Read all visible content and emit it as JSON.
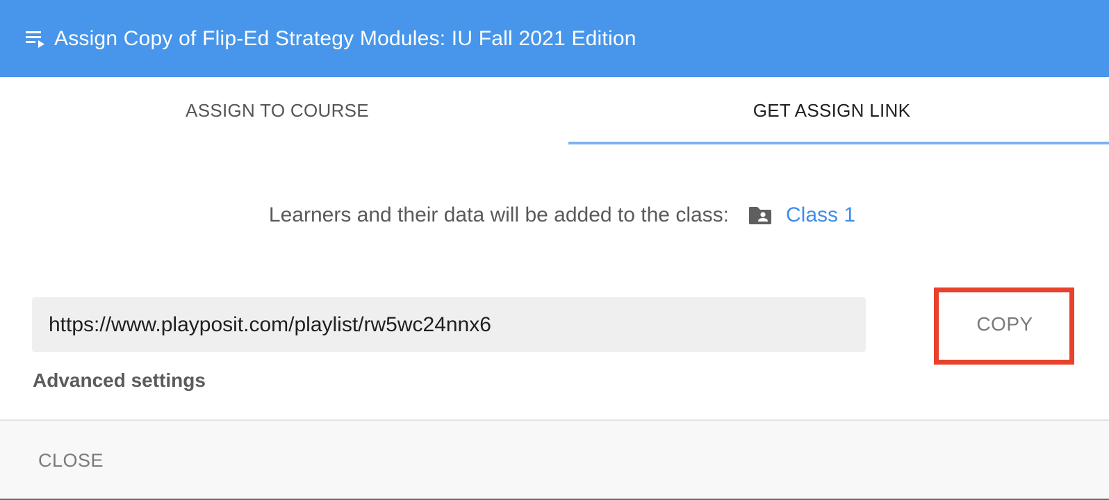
{
  "header": {
    "icon": "playlist-play-icon",
    "title": "Assign Copy of Flip-Ed Strategy Modules: IU Fall 2021 Edition"
  },
  "tabs": [
    {
      "label": "ASSIGN TO COURSE",
      "active": false
    },
    {
      "label": "GET ASSIGN LINK",
      "active": true
    }
  ],
  "class_info": {
    "text": "Learners and their data will be added to the class:",
    "icon": "folder-account-icon",
    "class_name": "Class 1"
  },
  "link": {
    "url": "https://www.playposit.com/playlist/rw5wc24nnx6",
    "copy_label": "COPY"
  },
  "advanced_settings_label": "Advanced settings",
  "footer": {
    "close_label": "CLOSE"
  },
  "colors": {
    "header_bg": "#4796eb",
    "accent_link": "#3d8ee6",
    "tab_indicator": "#7fb0f0",
    "highlight_border": "#e8412c"
  }
}
